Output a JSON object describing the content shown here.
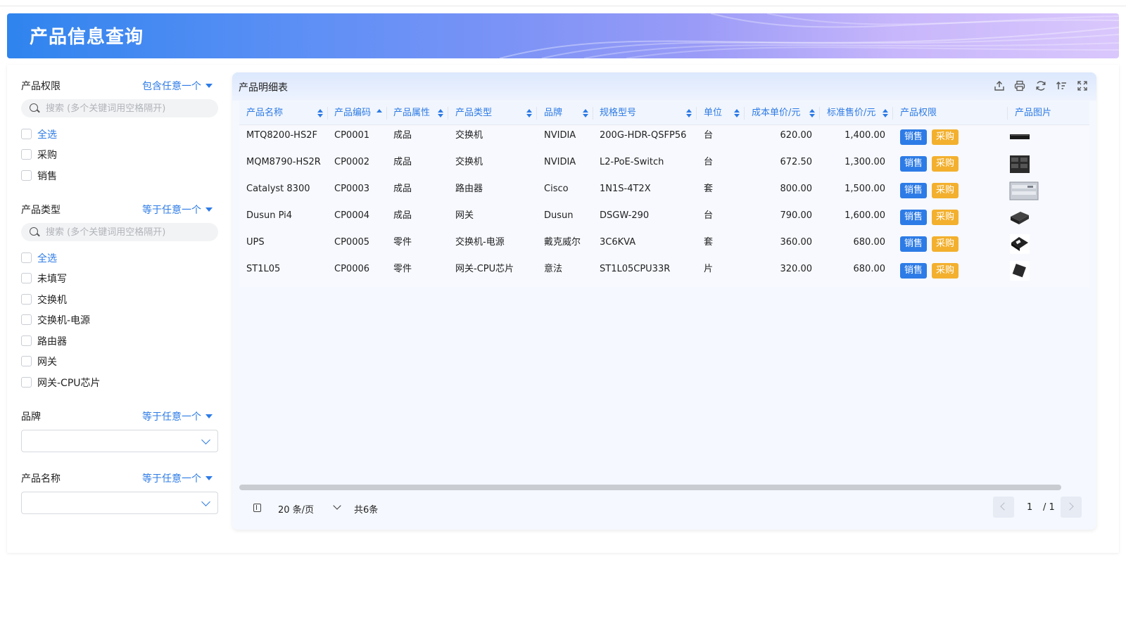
{
  "page": {
    "title": "产品信息查询"
  },
  "filters": {
    "permission": {
      "label": "产品权限",
      "operator": "包含任意一个",
      "search_placeholder": "搜索 (多个关键词用空格隔开)",
      "options": [
        "全选",
        "采购",
        "销售"
      ]
    },
    "type": {
      "label": "产品类型",
      "operator": "等于任意一个",
      "search_placeholder": "搜索 (多个关键词用空格隔开)",
      "options": [
        "全选",
        "未填写",
        "交换机",
        "交换机-电源",
        "路由器",
        "网关",
        "网关-CPU芯片"
      ]
    },
    "brand": {
      "label": "品牌",
      "operator": "等于任意一个",
      "value": ""
    },
    "name": {
      "label": "产品名称",
      "operator": "等于任意一个",
      "value": ""
    }
  },
  "table": {
    "title": "产品明细表",
    "toolbar_icons": [
      "export-icon",
      "print-icon",
      "refresh-icon",
      "column-sort-icon",
      "fullscreen-icon"
    ],
    "columns": [
      "产品名称",
      "产品编码",
      "产品属性",
      "产品类型",
      "品牌",
      "规格型号",
      "单位",
      "成本单价/元",
      "标准售价/元",
      "产品权限",
      "产品图片"
    ],
    "rows": [
      {
        "name": "MTQ8200-HS2F",
        "code": "CP0001",
        "attr": "成品",
        "type": "交换机",
        "brand": "NVIDIA",
        "model": "200G-HDR-QSFP56",
        "unit": "台",
        "cost": "620.00",
        "price": "1,400.00",
        "perm_sale": "销售",
        "perm_buy": "采购",
        "image": "switch-thin"
      },
      {
        "name": "MQM8790-HS2R",
        "code": "CP0002",
        "attr": "成品",
        "type": "交换机",
        "brand": "NVIDIA",
        "model": "L2-PoE-Switch",
        "unit": "台",
        "cost": "672.50",
        "price": "1,300.00",
        "perm_sale": "销售",
        "perm_buy": "采购",
        "image": "switch-ports"
      },
      {
        "name": "Catalyst 8300",
        "code": "CP0003",
        "attr": "成品",
        "type": "路由器",
        "brand": "Cisco",
        "model": "1N1S-4T2X",
        "unit": "套",
        "cost": "800.00",
        "price": "1,500.00",
        "perm_sale": "销售",
        "perm_buy": "采购",
        "image": "router-rack"
      },
      {
        "name": "Dusun Pi4",
        "code": "CP0004",
        "attr": "成品",
        "type": "网关",
        "brand": "Dusun",
        "model": "DSGW-290",
        "unit": "台",
        "cost": "790.00",
        "price": "1,600.00",
        "perm_sale": "销售",
        "perm_buy": "采购",
        "image": "gateway-box"
      },
      {
        "name": "UPS",
        "code": "CP0005",
        "attr": "零件",
        "type": "交换机-电源",
        "brand": "戴克威尔",
        "model": "3C6KVA",
        "unit": "套",
        "cost": "360.00",
        "price": "680.00",
        "perm_sale": "销售",
        "perm_buy": "采购",
        "image": "power-module"
      },
      {
        "name": "ST1L05",
        "code": "CP0006",
        "attr": "零件",
        "type": "网关-CPU芯片",
        "brand": "意法",
        "model": "ST1L05CPU33R",
        "unit": "片",
        "cost": "320.00",
        "price": "680.00",
        "perm_sale": "销售",
        "perm_buy": "采购",
        "image": "chip"
      }
    ]
  },
  "pagination": {
    "page_size": "20 条/页",
    "total": "共6条",
    "current_page": "1",
    "total_pages": "/ 1"
  },
  "colors": {
    "accent": "#2d7be6",
    "sale_tag": "#2d7be6",
    "buy_tag": "#f3b02e"
  }
}
